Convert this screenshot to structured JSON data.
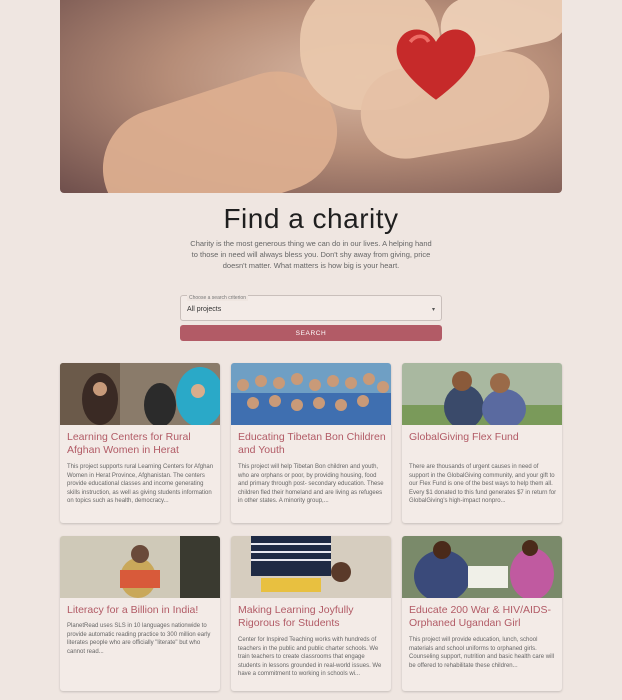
{
  "page": {
    "title": "Find a charity",
    "lead": "Charity is the most generous thing we can do in our lives. A helping hand to those in need will always bless you. Don't shy away from giving, price doesn't matter. What matters is how big is your heart."
  },
  "search": {
    "label": "Choose a search criterion",
    "value": "All projects",
    "button": "SEARCH"
  },
  "colors": {
    "accent": "#b25b66",
    "background": "#efe6e1"
  },
  "projects": [
    {
      "title": "Learning Centers for Rural Afghan Women in Herat",
      "desc": "This project supports rural Learning Centers for Afghan Women in Herat Province, Afghanistan. The centers provide educational classes and income generating skills instruction, as well as giving students information on topics such as health, democracy..."
    },
    {
      "title": "Educating Tibetan Bon Children and Youth",
      "desc": "This project will help Tibetan Bon children and youth, who are orphans or poor, by providing housing, food and primary through post- secondary education. These children fled their homeland and are living as refugees in other states. A minority group,..."
    },
    {
      "title": "GlobalGiving Flex Fund",
      "desc": "There are thousands of urgent causes in need of support in the GlobalGiving community, and your gift to our Flex Fund is one of the best ways to help them all. Every $1 donated to this fund generates $7 in return for GlobalGiving's high-impact nonpro..."
    },
    {
      "title": "Literacy for a Billion in India!",
      "desc": "PlanetRead uses SLS in 10 languages nationwide to provide automatic reading practice to 300 million early literates people who are officially \"literate\" but who cannot read..."
    },
    {
      "title": "Making Learning Joyfully Rigorous for Students",
      "desc": "Center for Inspired Teaching works with hundreds of teachers in the public and public charter schools. We train teachers to create classrooms that engage students in lessons grounded in real-world issues. We have a commitment to working in schools wi..."
    },
    {
      "title": "Educate 200 War & HIV/AIDS-Orphaned Ugandan Girl",
      "desc": "This project will provide education, lunch, school materials and school uniforms to orphaned girls. Counseling support, nutrition and basic health care will be offered to rehabilitate these children..."
    }
  ]
}
